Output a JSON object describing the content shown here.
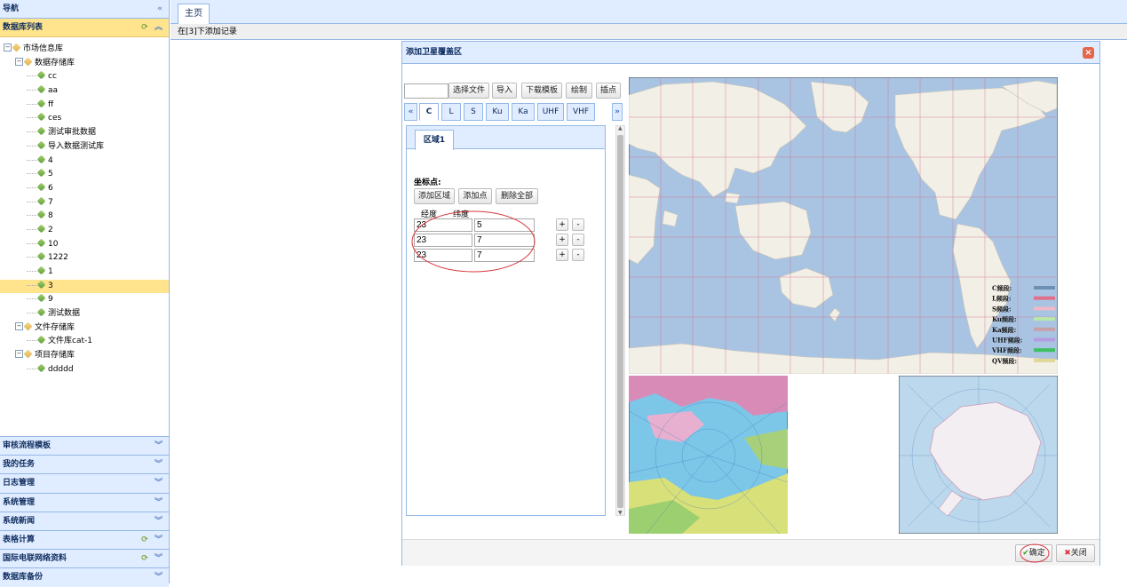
{
  "sidebar": {
    "nav_title": "导航",
    "db_title": "数据库列表",
    "tree": [
      {
        "label": "市场信息库",
        "level": 0,
        "type": "folder"
      },
      {
        "label": "数据存储库",
        "level": 1,
        "type": "folder"
      },
      {
        "label": "cc",
        "level": 2,
        "type": "leaf"
      },
      {
        "label": "aa",
        "level": 2,
        "type": "leaf"
      },
      {
        "label": "ff",
        "level": 2,
        "type": "leaf"
      },
      {
        "label": "ces",
        "level": 2,
        "type": "leaf"
      },
      {
        "label": "测试审批数据",
        "level": 2,
        "type": "leaf"
      },
      {
        "label": "导入数据测试库",
        "level": 2,
        "type": "leaf"
      },
      {
        "label": "4",
        "level": 2,
        "type": "leaf"
      },
      {
        "label": "5",
        "level": 2,
        "type": "leaf"
      },
      {
        "label": "6",
        "level": 2,
        "type": "leaf"
      },
      {
        "label": "7",
        "level": 2,
        "type": "leaf"
      },
      {
        "label": "8",
        "level": 2,
        "type": "leaf"
      },
      {
        "label": "2",
        "level": 2,
        "type": "leaf"
      },
      {
        "label": "10",
        "level": 2,
        "type": "leaf"
      },
      {
        "label": "1222",
        "level": 2,
        "type": "leaf"
      },
      {
        "label": "1",
        "level": 2,
        "type": "leaf"
      },
      {
        "label": "3",
        "level": 2,
        "type": "leaf",
        "selected": true
      },
      {
        "label": "9",
        "level": 2,
        "type": "leaf"
      },
      {
        "label": "测试数据",
        "level": 2,
        "type": "leaf"
      },
      {
        "label": "文件存储库",
        "level": 1,
        "type": "folder"
      },
      {
        "label": "文件库cat-1",
        "level": 2,
        "type": "leaf"
      },
      {
        "label": "项目存储库",
        "level": 1,
        "type": "folder"
      },
      {
        "label": "ddddd",
        "level": 2,
        "type": "leaf"
      }
    ],
    "accordion": [
      {
        "label": "审核流程模板",
        "refresh": false
      },
      {
        "label": "我的任务",
        "refresh": false
      },
      {
        "label": "日志管理",
        "refresh": false
      },
      {
        "label": "系统管理",
        "refresh": false
      },
      {
        "label": "系统新闻",
        "refresh": false
      },
      {
        "label": "表格计算",
        "refresh": true
      },
      {
        "label": "国际电联网络资料",
        "refresh": true
      },
      {
        "label": "数据库备份",
        "refresh": false
      }
    ]
  },
  "main": {
    "tab_home": "主页",
    "breadcrumb": "在[3]下添加记录"
  },
  "dialog": {
    "title": "添加卫星覆盖区",
    "toolbar": {
      "select_file": "选择文件",
      "import": "导入",
      "download_template": "下载模板",
      "draw": "绘制",
      "pick_point": "插点"
    },
    "band_tabs": [
      "C",
      "L",
      "S",
      "Ku",
      "Ka",
      "UHF",
      "VHF"
    ],
    "active_band": "C",
    "region_tab": "区域1",
    "coords_label": "坐标点:",
    "add_region": "添加区域",
    "add_point": "添加点",
    "delete_all": "删除全部",
    "col_lon": "经度",
    "col_lat": "纬度",
    "points": [
      {
        "lon": "23",
        "lat": "5"
      },
      {
        "lon": "23",
        "lat": "7"
      },
      {
        "lon": "23",
        "lat": "7"
      }
    ],
    "plus": "+",
    "minus": "-",
    "legend": [
      {
        "label": "C频段:",
        "color": "#6d8fb3"
      },
      {
        "label": "L频段:",
        "color": "#e0708a"
      },
      {
        "label": "S频段:",
        "color": "#f0b8c8"
      },
      {
        "label": "Ku频段:",
        "color": "#b8e8a8"
      },
      {
        "label": "Ka频段:",
        "color": "#c8a0a8"
      },
      {
        "label": "UHF频段:",
        "color": "#b59be0"
      },
      {
        "label": "VHF频段:",
        "color": "#3cc060"
      },
      {
        "label": "QV频段:",
        "color": "#e0d89a"
      }
    ],
    "confirm": "确定",
    "close": "关闭"
  },
  "colors": {
    "header_bg": "#e0ecff",
    "border": "#95b8e7",
    "selected": "#ffe48d",
    "ocean": "#a9c4e2",
    "land": "#f2efe6"
  }
}
